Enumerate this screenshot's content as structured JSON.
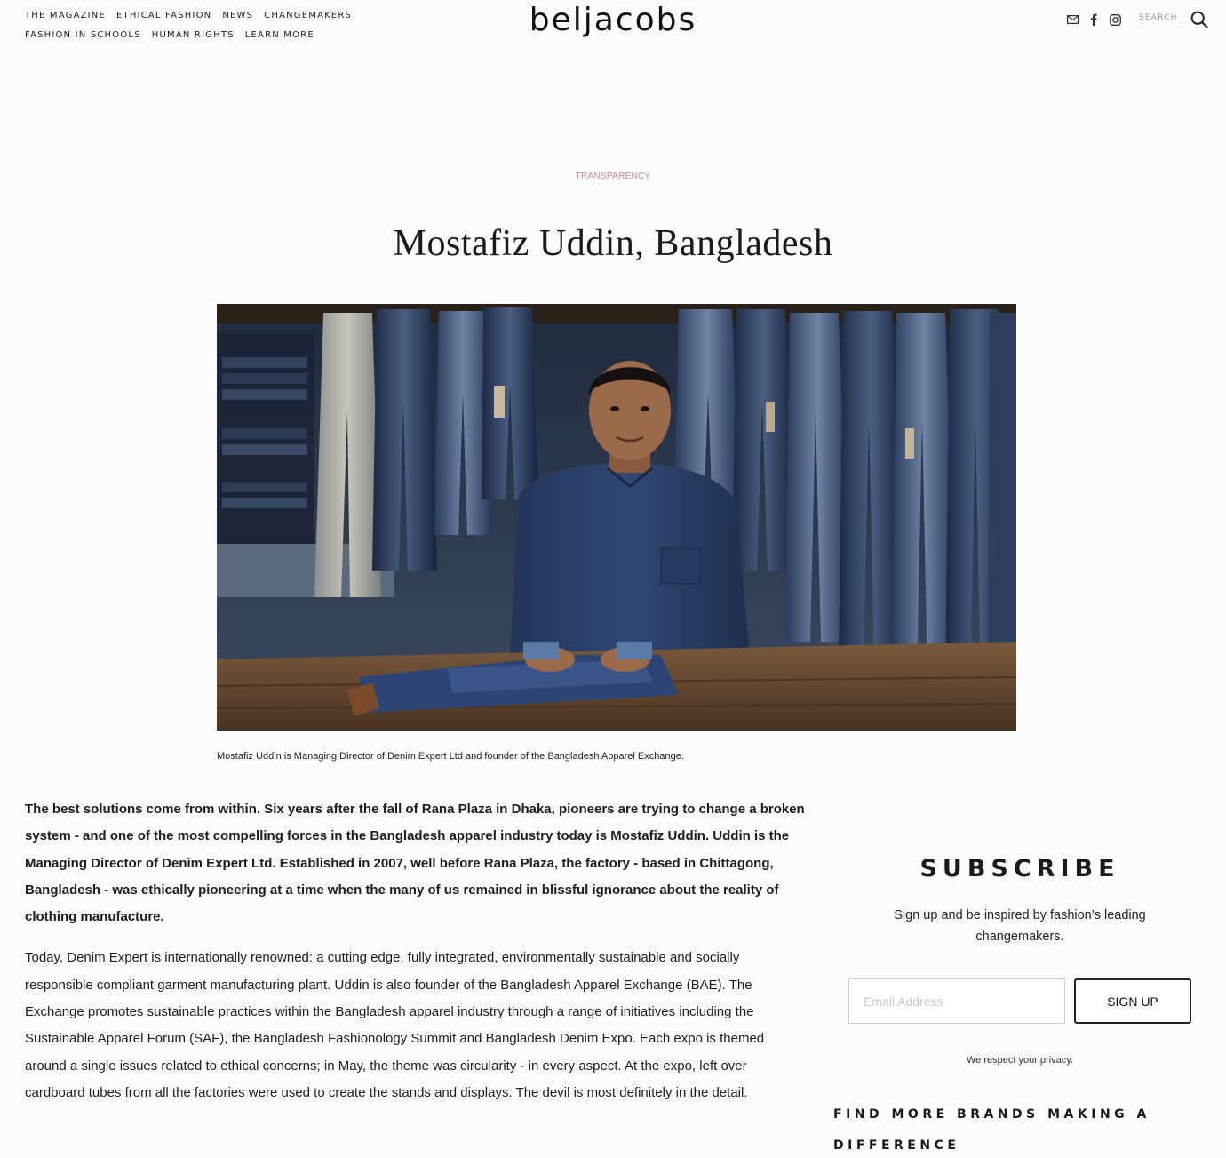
{
  "nav": {
    "row1": [
      "THE MAGAZINE",
      "ETHICAL FASHION",
      "NEWS",
      "CHANGEMAKERS"
    ],
    "row2": [
      "FASHION IN SCHOOLS",
      "HUMAN RIGHTS",
      "LEARN MORE"
    ]
  },
  "logo": "beljacobs",
  "header_icons": [
    "mail-icon",
    "facebook-icon",
    "instagram-icon"
  ],
  "search": {
    "placeholder": "SEARCH"
  },
  "article": {
    "category": "TRANSPARENCY",
    "title": "Mostafiz Uddin, Bangladesh",
    "caption": "Mostafiz Uddin is Managing Director of Denim Expert Ltd and founder of the Bangladesh Apparel Exchange.",
    "lead": "The best solutions come from within. Six years after the fall of Rana Plaza in Dhaka, pioneers are trying to change a broken system - and one of the most compelling forces in the Bangladesh apparel industry today is Mostafiz Uddin. Uddin is the Managing Director of Denim Expert Ltd. Established in 2007, well before Rana Plaza, the factory - based in Chittagong, Bangladesh - was ethically pioneering at a time when the many of us remained in blissful ignorance about the reality of clothing manufacture.",
    "paragraph2": "Today, Denim Expert is  internationally renowned: a cutting edge, fully integrated, environmentally sustainable and socially responsible compliant garment manufacturing plant. Uddin is also founder of the Bangladesh Apparel Exchange (BAE). The Exchange promotes sustainable practices within the Bangladesh apparel industry through a range of initiatives including the Sustainable Apparel Forum (SAF), the Bangladesh Fashionology Summit and Bangladesh Denim Expo. Each expo is themed around a single issues related to ethical concerns; in May, the theme was circularity - in every aspect. At the expo, left over cardboard tubes from all the factories were used to create the stands and displays. The devil is most definitely in the detail."
  },
  "sidebar": {
    "subscribe_title": "SUBSCRIBE",
    "subscribe_text": "Sign up and be inspired by fashion’s leading changemakers.",
    "email_placeholder": "Email Address",
    "signup_label": "SIGN UP",
    "privacy": "We respect your privacy.",
    "find_more": "FIND MORE BRANDS MAKING A DIFFERENCE"
  },
  "colors": {
    "background": "#fcfbfb",
    "category": "#d4888c",
    "text": "#1d1d1d"
  }
}
